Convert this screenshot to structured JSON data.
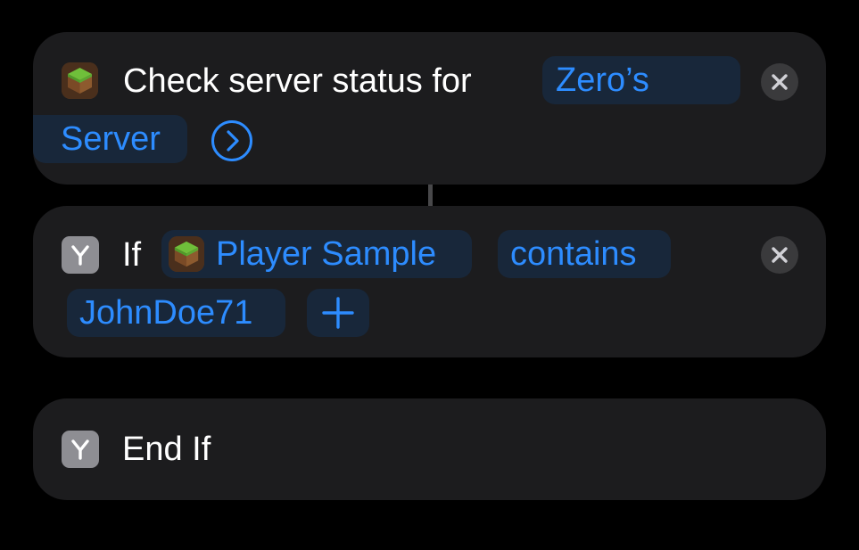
{
  "actions": {
    "check_status": {
      "label": "Check server status for",
      "server_token_part1": "Zero’s",
      "server_token_part2": "Server",
      "expand_icon": "chevron-right-circle-icon",
      "app_icon": "minecraft-grass-block-icon",
      "remove_icon": "close-icon"
    },
    "if": {
      "keyword": "If",
      "variable": "Player Sample",
      "condition": "contains",
      "value": "JohnDoe71",
      "add_icon": "plus-icon",
      "branch_icon": "branch-icon",
      "remove_icon": "close-icon"
    },
    "end_if": {
      "label": "End If",
      "branch_icon": "branch-icon"
    }
  },
  "colors": {
    "background": "#000000",
    "card": "#1c1c1e",
    "token_bg": "#18273a",
    "accent": "#2d8cff",
    "close_bg": "#3a3a3c",
    "branch_icon_bg": "#8e8e93"
  }
}
